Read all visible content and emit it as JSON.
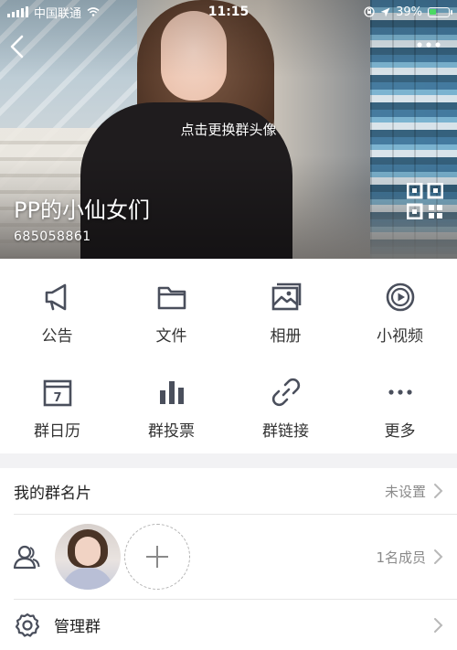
{
  "status_bar": {
    "carrier": "中国联通",
    "time": "11:15",
    "battery": "39%",
    "battery_level": 0.39
  },
  "hero": {
    "change_avatar_hint": "点击更换群头像",
    "group_name": "PP的小仙女们",
    "group_id": "685058861"
  },
  "features": [
    {
      "label": "公告",
      "icon": "megaphone-icon"
    },
    {
      "label": "文件",
      "icon": "folder-icon"
    },
    {
      "label": "相册",
      "icon": "photo-album-icon"
    },
    {
      "label": "小视频",
      "icon": "video-icon"
    },
    {
      "label": "群日历",
      "icon": "calendar-icon",
      "calendar_day": "7"
    },
    {
      "label": "群投票",
      "icon": "bar-chart-icon"
    },
    {
      "label": "群链接",
      "icon": "link-icon"
    },
    {
      "label": "更多",
      "icon": "more-dots-icon"
    }
  ],
  "list": {
    "card": {
      "title": "我的群名片",
      "value": "未设置"
    },
    "members": {
      "count_label": "1名成员"
    },
    "manage": {
      "title": "管理群"
    }
  },
  "colors": {
    "icon": "#4a4f5c",
    "battery_fill": "#4cd964",
    "chevron": "#b8b8b8"
  }
}
